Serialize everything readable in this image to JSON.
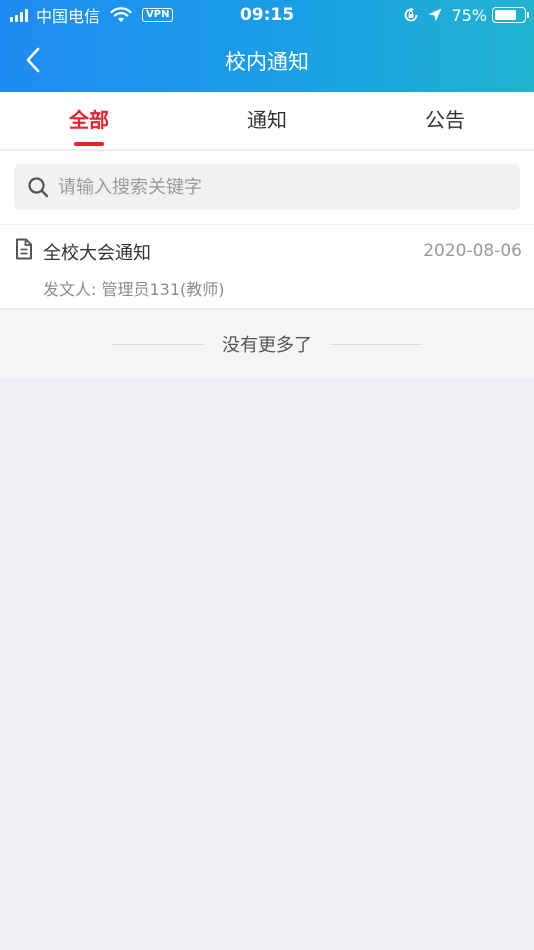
{
  "status_bar": {
    "carrier": "中国电信",
    "vpn": "VPN",
    "time": "09:15",
    "battery_pct": "75%",
    "battery_level": 0.75
  },
  "nav": {
    "title": "校内通知",
    "back_icon": "chevron-left-icon"
  },
  "colors": {
    "header_gradient_start": "#1f8bf3",
    "header_gradient_end": "#21b3cf",
    "accent": "#e8222b"
  },
  "tabs": [
    {
      "label": "全部",
      "active": true
    },
    {
      "label": "通知",
      "active": false
    },
    {
      "label": "公告",
      "active": false
    }
  ],
  "search": {
    "placeholder": "请输入搜索关键字",
    "value": ""
  },
  "notices": [
    {
      "title": "全校大会通知",
      "date": "2020-08-06",
      "sender": "发文人: 管理员131(教师)"
    }
  ],
  "footer": {
    "no_more": "没有更多了"
  }
}
